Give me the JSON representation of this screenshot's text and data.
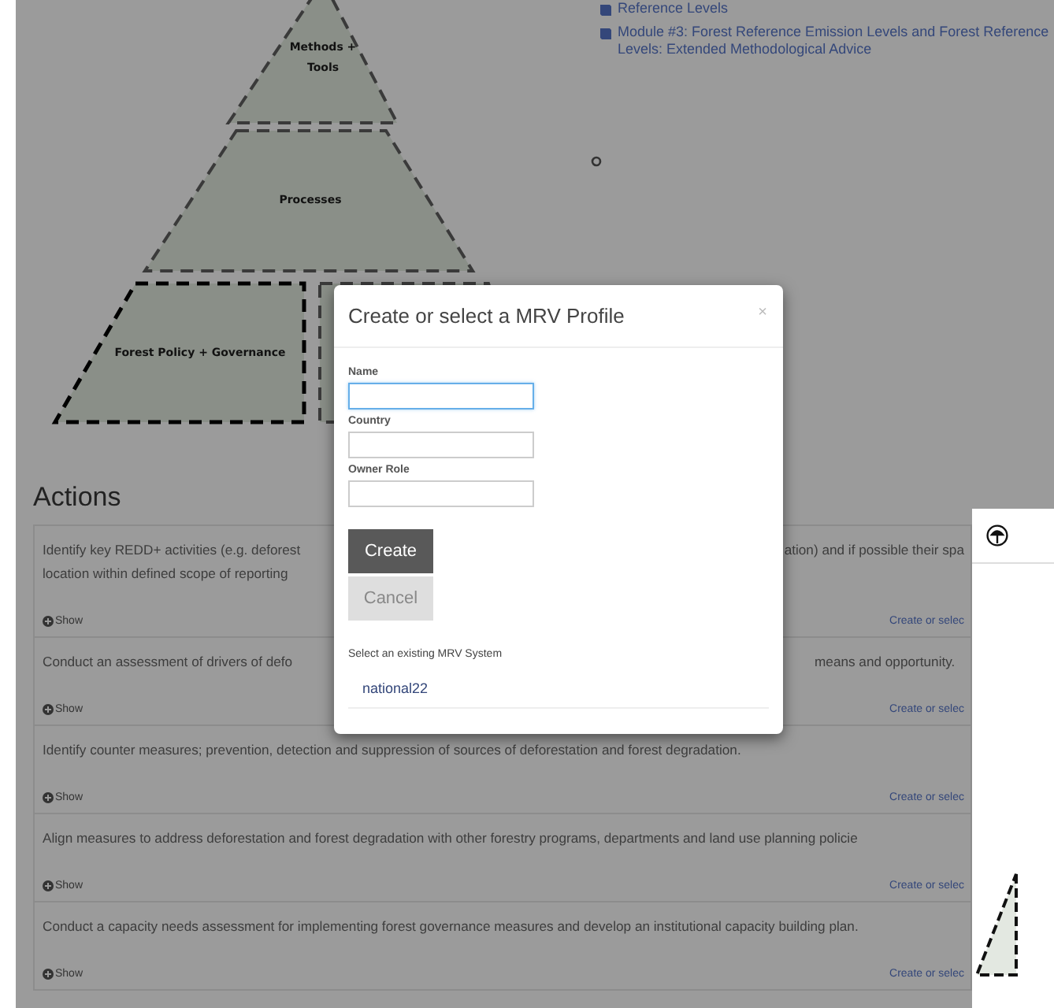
{
  "links": [
    {
      "text": "Reference Levels"
    },
    {
      "text": "Module #3: Forest Reference Emission Levels and Forest Reference Levels: Extended Methodological Advice"
    }
  ],
  "pyramid": {
    "tiers": [
      {
        "label": "Methods + Tools",
        "highlighted": false
      },
      {
        "label": "Processes",
        "highlighted": false
      },
      {
        "label": "Forest Policy + Governance",
        "highlighted": true
      }
    ]
  },
  "actions": {
    "title": "Actions",
    "items": [
      {
        "lines": [
          {
            "left": "Identify key REDD+ activities (e.g. deforest",
            "right": "ation) and if possible their spa"
          },
          {
            "left": "location within defined scope of reporting"
          }
        ],
        "show": "Show",
        "link": "Create or selec"
      },
      {
        "lines": [
          {
            "left": "Conduct an assessment of drivers of defo",
            "right": "means and opportunity."
          }
        ],
        "show": "Show",
        "link": "Create or selec"
      },
      {
        "lines": [
          {
            "left": "Identify counter measures; prevention, detection and suppression of sources of deforestation and forest degradation."
          }
        ],
        "show": "Show",
        "link": "Create or selec"
      },
      {
        "lines": [
          {
            "left": "Align measures to address deforestation and forest degradation with other forestry programs, departments and land use planning policie"
          }
        ],
        "show": "Show",
        "link": "Create or selec"
      },
      {
        "lines": [
          {
            "left": "Conduct a capacity needs assessment for implementing forest governance measures and develop an institutional capacity building plan."
          }
        ],
        "show": "Show",
        "link": "Create or selec"
      }
    ]
  },
  "dialog": {
    "title": "Create or select a MRV Profile",
    "close": "×",
    "fields": [
      {
        "label": "Name",
        "focused": true
      },
      {
        "label": "Country",
        "focused": false
      },
      {
        "label": "Owner Role",
        "focused": false
      }
    ],
    "buttons": [
      {
        "label": "Create",
        "kind": "primary"
      },
      {
        "label": "Cancel",
        "kind": "secondary"
      }
    ],
    "existing_label": "Select an existing MRV System",
    "systems": [
      {
        "name": "national22"
      }
    ]
  }
}
